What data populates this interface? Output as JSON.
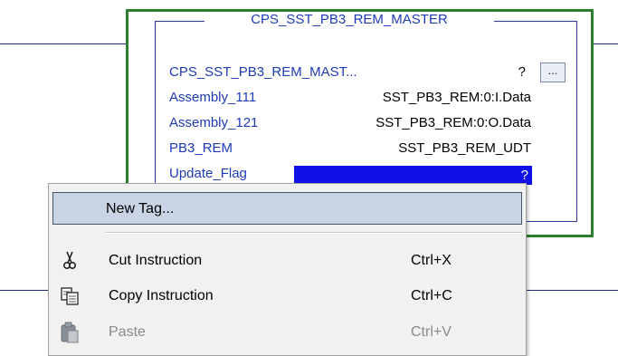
{
  "instruction": {
    "title": "CPS_SST_PB3_REM_MASTER",
    "header_param": {
      "name": "CPS_SST_PB3_REM_MAST...",
      "value": "?",
      "button_label": "..."
    },
    "params": [
      {
        "name": "Assembly_111",
        "value": "SST_PB3_REM:0:I.Data"
      },
      {
        "name": "Assembly_121",
        "value": "SST_PB3_REM:0:O.Data"
      },
      {
        "name": "PB3_REM",
        "value": "SST_PB3_REM_UDT"
      }
    ],
    "selected_param": {
      "name": "Update_Flag",
      "value": "?"
    }
  },
  "context_menu": {
    "items": [
      {
        "label": "New Tag...",
        "shortcut": "",
        "icon": "none",
        "state": "hovered"
      },
      {
        "label": "Cut Instruction",
        "shortcut": "Ctrl+X",
        "icon": "scissors-icon",
        "state": "enabled"
      },
      {
        "label": "Copy Instruction",
        "shortcut": "Ctrl+C",
        "icon": "copy-icon",
        "state": "enabled"
      },
      {
        "label": "Paste",
        "shortcut": "Ctrl+V",
        "icon": "paste-icon",
        "state": "disabled"
      }
    ]
  },
  "colors": {
    "selection_outline": "#2e7d32",
    "instruction_text": "#1f3bb4",
    "highlight_bg": "#1010e8",
    "menu_hover_bg": "#c8d3e4"
  }
}
